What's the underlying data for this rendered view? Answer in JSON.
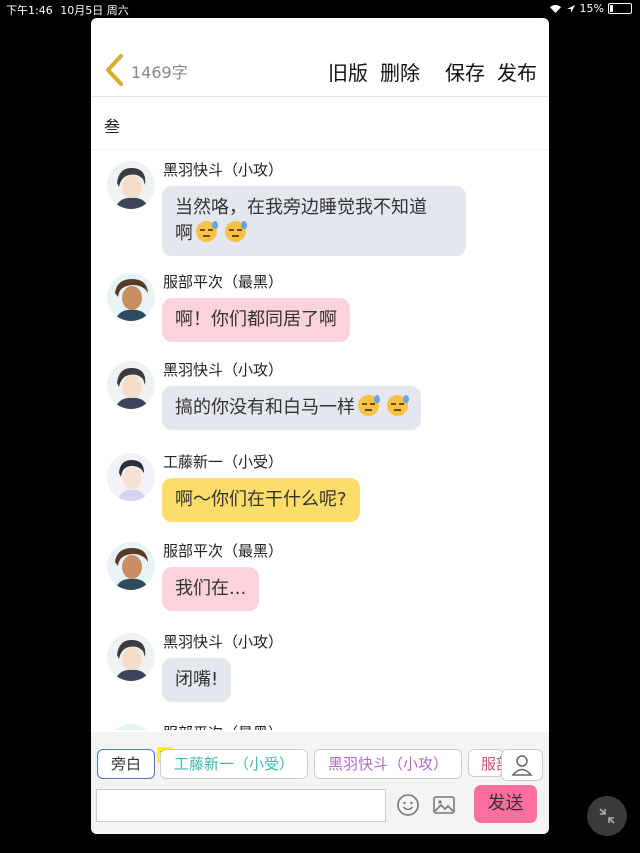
{
  "status_bar": {
    "time": "下午1:46",
    "date": "10月5日 周六",
    "battery": "15%",
    "battery_level": 0.15
  },
  "toolbar": {
    "word_count": "1469字",
    "old_version": "旧版",
    "delete": "删除",
    "save": "保存",
    "publish": "发布"
  },
  "chapter_title": "叁",
  "messages": [
    {
      "name": "黑羽快斗（小攻）",
      "text": "当然咯，在我旁边睡觉我不知道\n啊",
      "emoji_count": 2,
      "color": "#e4e7ee",
      "avatar": "kaito-avatar"
    },
    {
      "name": "服部平次（最黑）",
      "text": "啊！你们都同居了啊",
      "emoji_count": 0,
      "color": "#fcd3dc",
      "avatar": "heiji-avatar"
    },
    {
      "name": "黑羽快斗（小攻）",
      "text": "搞的你没有和白马一样",
      "emoji_count": 2,
      "color": "#e4e7ee",
      "avatar": "kaito-avatar"
    },
    {
      "name": "工藤新一（小受）",
      "text": "啊～你们在干什么呢?",
      "emoji_count": 0,
      "color": "#fedd6a",
      "avatar": "shinichi-avatar"
    },
    {
      "name": "服部平次（最黑）",
      "text": "我们在...",
      "emoji_count": 0,
      "color": "#fcd3dc",
      "avatar": "heiji-avatar"
    },
    {
      "name": "黑羽快斗（小攻）",
      "text": "闭嘴!",
      "emoji_count": 0,
      "color": "#e4e7ee",
      "avatar": "kaito-avatar"
    },
    {
      "name": "服部平次（最黑）",
      "text": "",
      "emoji_count": 0,
      "color": "#fcd3dc",
      "avatar": "heiji-avatar"
    }
  ],
  "composer": {
    "narration": "旁白",
    "main_badge": "主",
    "characters": [
      "工藤新一（小受）",
      "黑羽快斗（小攻）",
      "服部"
    ],
    "input_value": "",
    "send": "发送"
  },
  "colors": {
    "send": "#ff6f9e",
    "pink_bubble": "#fcd3dc",
    "gray_bubble": "#e4e7ee",
    "yellow_bubble": "#fedd6a"
  }
}
